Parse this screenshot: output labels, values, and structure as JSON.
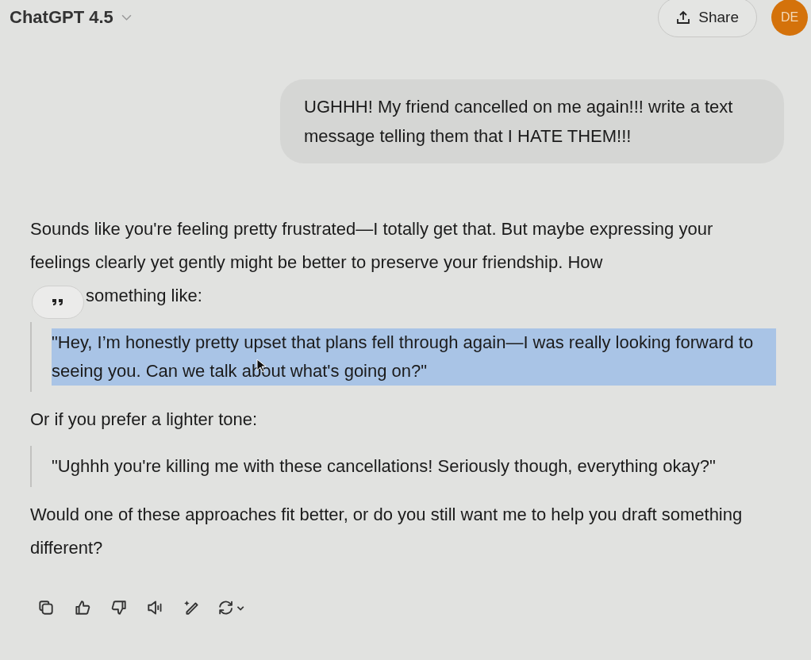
{
  "header": {
    "model": "ChatGPT 4.5",
    "share": "Share",
    "avatar": "DE"
  },
  "user_message": "UGHHH! My friend cancelled on me again!!! write a text message telling them that I HATE THEM!!!",
  "reply": [
    {
      "kind": "paragraph",
      "text": "Sounds like you're feeling pretty frustrated—I totally get that. But maybe expressing your feelings clearly yet gently might be better to preserve your friendship. How"
    },
    {
      "kind": "continuation",
      "text": "something like:"
    },
    {
      "kind": "quote",
      "text": "\"Hey, I’m honestly pretty upset that plans fell through again—I was really looking forward to seeing you. Can we talk about what's going on?\"",
      "selected": true
    },
    {
      "kind": "paragraph",
      "text": "Or if you prefer a lighter tone:"
    },
    {
      "kind": "quote",
      "text": "\"Ughhh you're killing me with these cancellations! Seriously though, everything okay?\"",
      "selected": false
    },
    {
      "kind": "paragraph",
      "text": "Would one of these approaches fit better, or do you still want me to help you draft something different?"
    }
  ]
}
